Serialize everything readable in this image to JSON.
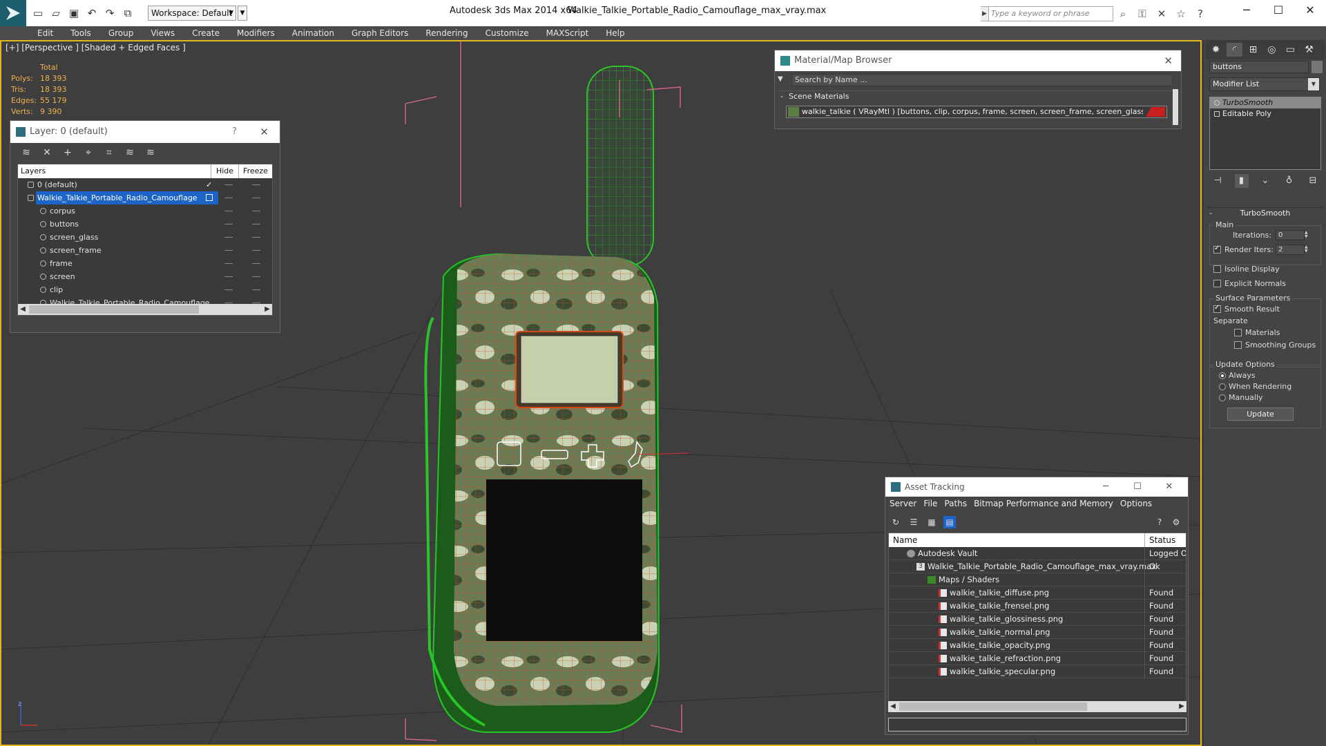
{
  "titlebar": {
    "workspace": "Workspace: Default",
    "app_title": "Autodesk 3ds Max  2014 x64",
    "file_title": "Walkie_Talkie_Portable_Radio_Camouflage_max_vray.max",
    "search_placeholder": "Type a keyword or phrase",
    "win_minimize": "─",
    "win_maximize": "☐",
    "win_close": "✕"
  },
  "menu": [
    "Edit",
    "Tools",
    "Group",
    "Views",
    "Create",
    "Modifiers",
    "Animation",
    "Graph Editors",
    "Rendering",
    "Customize",
    "MAXScript",
    "Help"
  ],
  "viewport": {
    "label": "[+] [Perspective ] [Shaded + Edged Faces ]",
    "stats": {
      "header": "Total",
      "polys_label": "Polys:",
      "polys": "18 393",
      "tris_label": "Tris:",
      "tris": "18 393",
      "edges_label": "Edges:",
      "edges": "55 179",
      "verts_label": "Verts:",
      "verts": "9 390"
    },
    "axis_z": "z"
  },
  "layer_panel": {
    "title": "Layer: 0 (default)",
    "help": "?",
    "col_layers": "Layers",
    "col_hide": "Hide",
    "col_freeze": "Freeze",
    "rows": [
      {
        "name": "0 (default)",
        "level": 0
      },
      {
        "name": "Walkie_Talkie_Portable_Radio_Camouflage",
        "level": 0
      },
      {
        "name": "corpus",
        "level": 1
      },
      {
        "name": "buttons",
        "level": 1
      },
      {
        "name": "screen_glass",
        "level": 1
      },
      {
        "name": "screen_frame",
        "level": 1
      },
      {
        "name": "frame",
        "level": 1
      },
      {
        "name": "screen",
        "level": 1
      },
      {
        "name": "clip",
        "level": 1
      },
      {
        "name": "Walkie_Talkie_Portable_Radio_Camouflage",
        "level": 1
      }
    ]
  },
  "material_browser": {
    "title": "Material/Map Browser",
    "search_placeholder": "Search by Name ...",
    "group": "Scene Materials",
    "material": "walkie_talkie  ( VRayMtl ) [buttons, clip, corpus, frame, screen, screen_frame, screen_glass]"
  },
  "command_panel": {
    "object_name": "buttons",
    "modifier_list": "Modifier List",
    "stack": [
      "TurboSmooth",
      "Editable Poly"
    ],
    "rollout_title": "TurboSmooth",
    "main_group": "Main",
    "iterations_label": "Iterations:",
    "iterations": "0",
    "render_iters_label": "Render Iters:",
    "render_iters": "2",
    "isoline": "Isoline Display",
    "explicit": "Explicit Normals",
    "surface_group": "Surface Parameters",
    "smooth_result": "Smooth Result",
    "separate": "Separate",
    "materials": "Materials",
    "smoothing_groups": "Smoothing Groups",
    "update_group": "Update Options",
    "always": "Always",
    "when_rendering": "When Rendering",
    "manually": "Manually",
    "update_button": "Update"
  },
  "asset_tracking": {
    "title": "Asset Tracking",
    "menu": [
      "Server",
      "File",
      "Paths",
      "Bitmap Performance and Memory",
      "Options"
    ],
    "col_name": "Name",
    "col_status": "Status",
    "rows": [
      {
        "name": "Autodesk Vault",
        "status": "Logged Out",
        "level": 0
      },
      {
        "name": "Walkie_Talkie_Portable_Radio_Camouflage_max_vray.max",
        "status": "Ok",
        "level": 1
      },
      {
        "name": "Maps / Shaders",
        "status": "",
        "level": 2
      },
      {
        "name": "walkie_talkie_diffuse.png",
        "status": "Found",
        "level": 3
      },
      {
        "name": "walkie_talkie_frensel.png",
        "status": "Found",
        "level": 3
      },
      {
        "name": "walkie_talkie_glossiness.png",
        "status": "Found",
        "level": 3
      },
      {
        "name": "walkie_talkie_normal.png",
        "status": "Found",
        "level": 3
      },
      {
        "name": "walkie_talkie_opacity.png",
        "status": "Found",
        "level": 3
      },
      {
        "name": "walkie_talkie_refraction.png",
        "status": "Found",
        "level": 3
      },
      {
        "name": "walkie_talkie_specular.png",
        "status": "Found",
        "level": 3
      }
    ]
  },
  "colors": {
    "viewport_border": "#e5b719",
    "selection": "#1c64c8",
    "stats": "#eeb14d",
    "wire_green": "#27c627",
    "wire_red": "#d24a1c"
  }
}
